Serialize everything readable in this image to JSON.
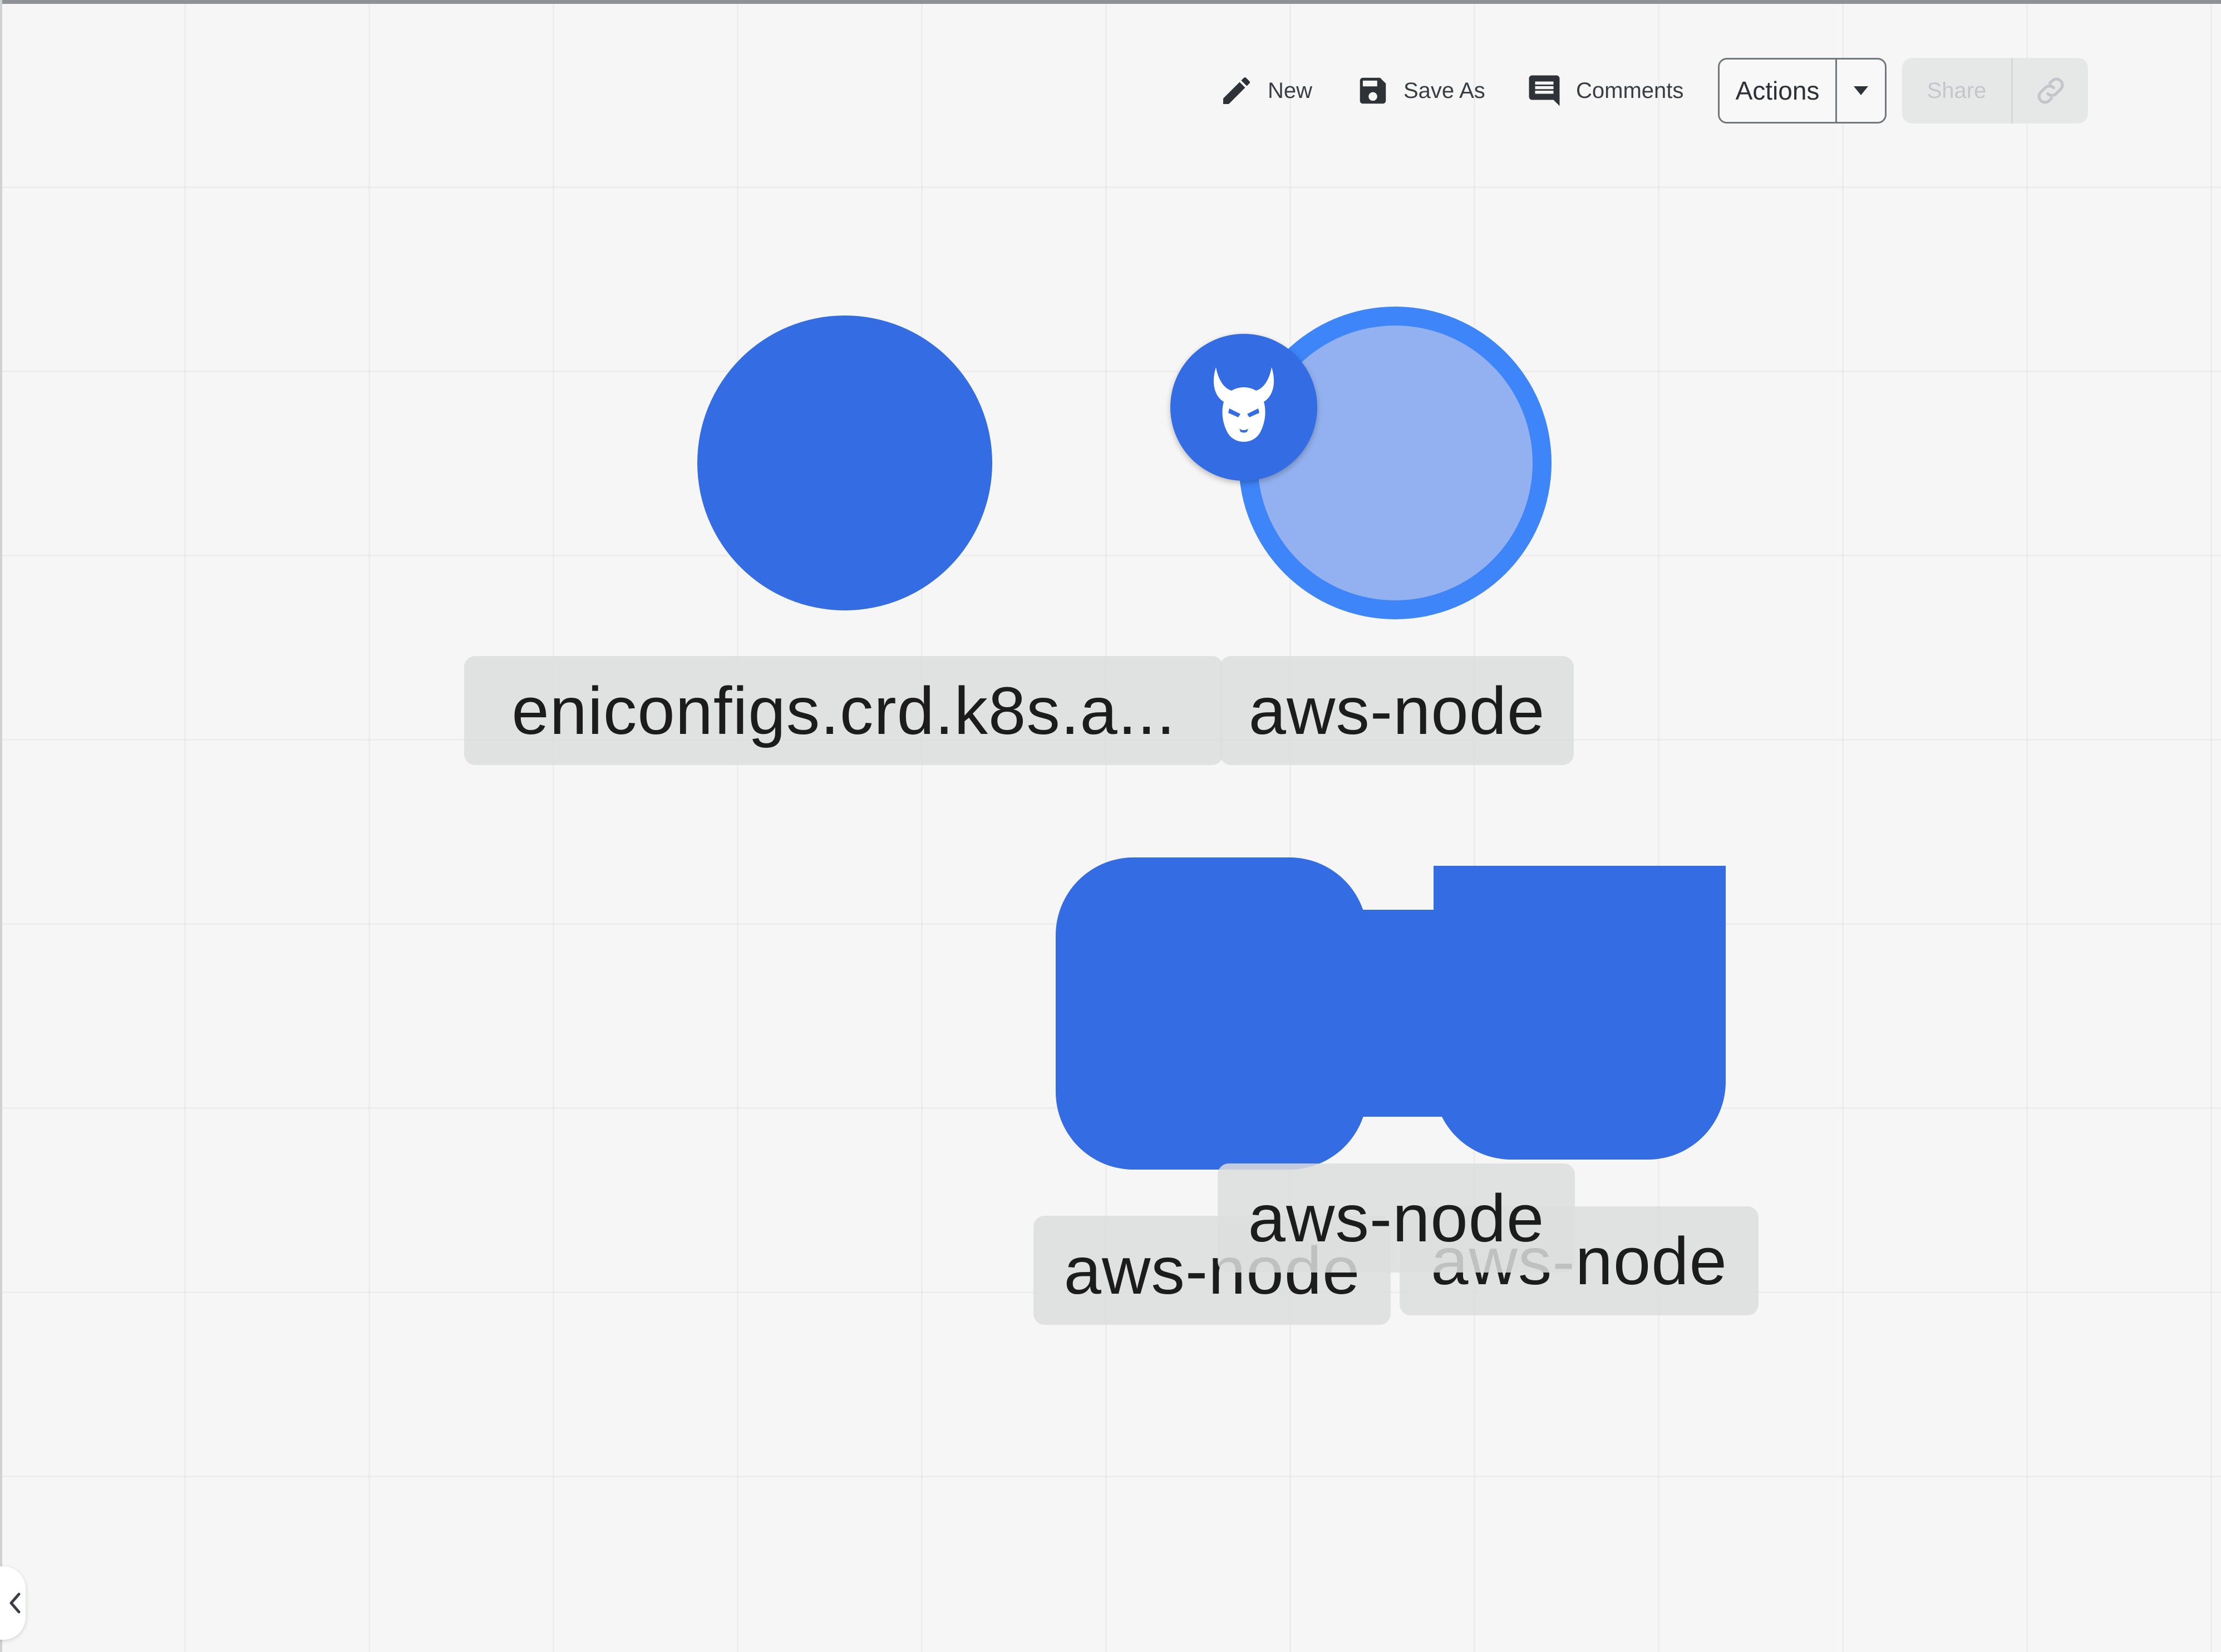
{
  "toolbar": {
    "new_label": "New",
    "new_icon": "pencil-icon",
    "save_as_label": "Save As",
    "save_as_icon": "floppy-disk-icon",
    "comments_label": "Comments",
    "comments_icon": "comment-icon",
    "actions_label": "Actions",
    "actions_caret_icon": "caret-down-icon",
    "share_label": "Share",
    "share_link_icon": "link-icon"
  },
  "canvas": {
    "nodes": [
      {
        "label": "eniconfigs.crd.k8s.a...",
        "shape": "circle",
        "color": "#336ce3"
      },
      {
        "label": "aws-node",
        "shape": "circle",
        "selected": true,
        "badge_icon": "devil-icon",
        "color": "#93b1f0",
        "ring_color": "#3d85f8"
      },
      {
        "label": "aws-node",
        "shape": "rounded-rect",
        "color": "#336ce3"
      },
      {
        "label": "aws-node",
        "shape": "rounded-rect",
        "color": "#336ce3"
      },
      {
        "label": "aws-node",
        "shape": "rounded-rect",
        "color": "#336ce3"
      }
    ],
    "edge_color": "#336ce3",
    "label_background": "#dcdddd"
  },
  "sidebar": {
    "collapse_icon": "chevron-left-icon"
  }
}
